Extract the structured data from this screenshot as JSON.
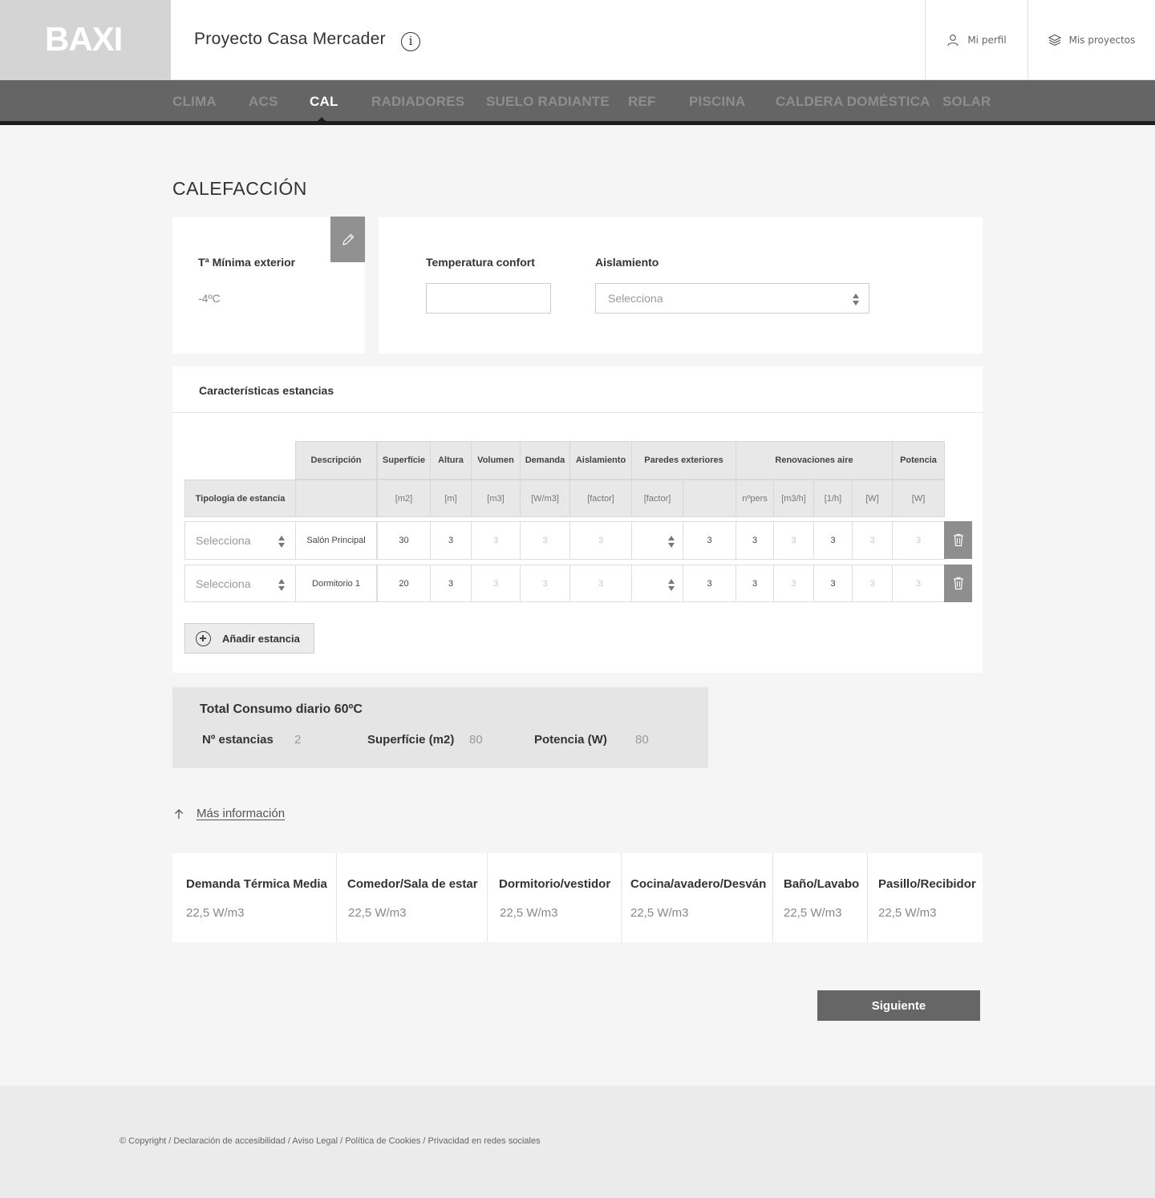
{
  "header": {
    "logo": "BAXI",
    "project_title": "Proyecto Casa Mercader",
    "profile_label": "Mi perfil",
    "projects_label": "Mis proyectos"
  },
  "nav": {
    "items": [
      "CLIMA",
      "ACS",
      "CAL",
      "RADIADORES",
      "SUELO RADIANTE",
      "REF",
      "PISCINA",
      "CALDERA DOMÉSTICA",
      "SOLAR"
    ],
    "active": "CAL"
  },
  "page_title": "CALEFACCIÓN",
  "tmin": {
    "label": "Tª Mínima exterior",
    "value": "-4ºC"
  },
  "confort": {
    "temp_label": "Temperatura confort",
    "temp_value": "",
    "aislamiento_label": "Aislamiento",
    "aislamiento_placeholder": "Selecciona"
  },
  "rooms": {
    "title": "Características estancias",
    "headers": {
      "descripcion": "Descripción",
      "superficie": "Superfície",
      "altura": "Altura",
      "volumen": "Volumen",
      "demanda": "Demanda",
      "aislamiento": "Aislamiento",
      "paredes": "Paredes exteriores",
      "renovaciones": "Renovaciones aire",
      "potencia": "Potencia",
      "tipologia": "Tipologia de estancia"
    },
    "units": {
      "superficie": "[m2]",
      "altura": "[m]",
      "volumen": "[m3]",
      "demanda": "[W/m3]",
      "aislamiento": "[factor]",
      "paredes": "[factor]",
      "npers": "nºpers",
      "m3h": "[m3/h]",
      "perh": "[1/h]",
      "w": "[W]",
      "potencia": "[W]"
    },
    "rows": [
      {
        "tipologia": "Selecciona",
        "descripcion": "Salón Principal",
        "superficie": "30",
        "altura": "3",
        "volumen": "3",
        "demanda": "3",
        "aislamiento": "3",
        "paredes_val": "3",
        "npers": "3",
        "m3h": "3",
        "perh": "3",
        "w": "3",
        "potencia": "3"
      },
      {
        "tipologia": "Selecciona",
        "descripcion": "Dormitorio 1",
        "superficie": "20",
        "altura": "3",
        "volumen": "3",
        "demanda": "3",
        "aislamiento": "3",
        "paredes_val": "3",
        "npers": "3",
        "m3h": "3",
        "perh": "3",
        "w": "3",
        "potencia": "3"
      }
    ],
    "add_label": "Añadir estancia"
  },
  "total": {
    "title": "Total Consumo diario 60ºC",
    "estancias_label": "Nº estancias",
    "estancias_value": "2",
    "superficie_label": "Superfície (m2)",
    "superficie_value": "80",
    "potencia_label": "Potencia (W)",
    "potencia_value": "80"
  },
  "more_info": "Más información",
  "demand": [
    {
      "label": "Demanda Térmica Media",
      "value": "22,5 W/m3"
    },
    {
      "label": "Comedor/Sala de estar",
      "value": "22,5 W/m3"
    },
    {
      "label": "Dormitorio/vestidor",
      "value": "22,5 W/m3"
    },
    {
      "label": "Cocina/avadero/Desván",
      "value": "22,5 W/m3"
    },
    {
      "label": "Baño/Lavabo",
      "value": "22,5 W/m3"
    },
    {
      "label": "Pasillo/Recibidor",
      "value": "22,5 W/m3"
    }
  ],
  "next_label": "Siguiente",
  "footer": "© Copyright / Declaración de accesibilidad / Aviso Legal / Política de Cookies / Privacidad en redes sociales",
  "colors": {
    "nav_bg": "#656565",
    "accent_dark": "#1e1e1e",
    "button": "#666666"
  }
}
